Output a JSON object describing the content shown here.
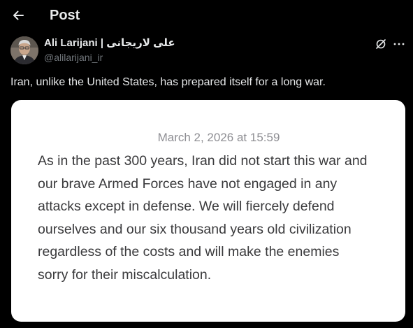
{
  "header": {
    "back_icon": "arrow-left-icon",
    "title": "Post"
  },
  "author": {
    "name": "Ali Larijani | علی لاریجانی",
    "handle": "@alilarijani_ir",
    "avatar_icon": "avatar-photo"
  },
  "actions": {
    "grok_icon": "grok-icon",
    "more_icon": "more-icon"
  },
  "post": {
    "text": "Iran, unlike the United States, has prepared itself for a long war."
  },
  "media": {
    "date": "March 2, 2026 at 15:59",
    "lines": [
      "As in the past 300 years, Iran did not start this war and",
      "our brave Armed Forces have not engaged in any",
      "attacks except in defense. We will fiercely defend",
      "ourselves and our six thousand years old civilization",
      "regardless of the costs and will make the enemies",
      "sorry for their miscalculation."
    ]
  },
  "colors": {
    "background": "#000000",
    "text_primary": "#e7e9ea",
    "text_secondary": "#71767b",
    "card_background": "#ffffff",
    "card_text": "#3a3a3c",
    "card_date": "#8e8e93"
  }
}
